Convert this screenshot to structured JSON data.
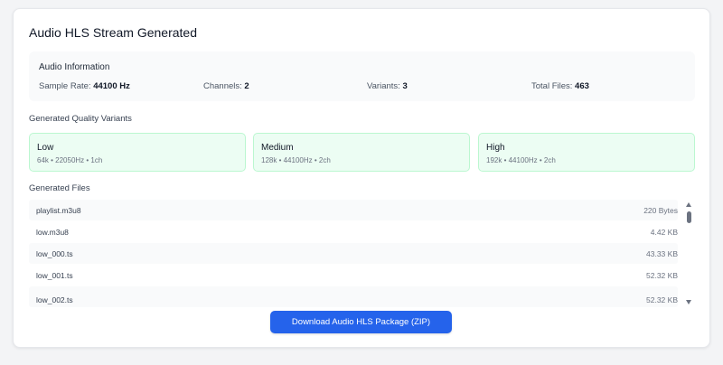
{
  "title": "Audio HLS Stream Generated",
  "audio_info": {
    "heading": "Audio Information",
    "items": [
      {
        "label": "Sample Rate:",
        "value": "44100 Hz"
      },
      {
        "label": "Channels:",
        "value": "2"
      },
      {
        "label": "Variants:",
        "value": "3"
      },
      {
        "label": "Total Files:",
        "value": "463"
      }
    ]
  },
  "variants_section": {
    "heading": "Generated Quality Variants",
    "items": [
      {
        "name": "Low",
        "detail": "64k • 22050Hz • 1ch"
      },
      {
        "name": "Medium",
        "detail": "128k • 44100Hz • 2ch"
      },
      {
        "name": "High",
        "detail": "192k • 44100Hz • 2ch"
      }
    ]
  },
  "files_section": {
    "heading": "Generated Files",
    "files": [
      {
        "name": "playlist.m3u8",
        "size": "220 Bytes"
      },
      {
        "name": "low.m3u8",
        "size": "4.42 KB"
      },
      {
        "name": "low_000.ts",
        "size": "43.33 KB"
      },
      {
        "name": "low_001.ts",
        "size": "52.32 KB"
      },
      {
        "name": "low_002.ts",
        "size": "52.32 KB"
      }
    ]
  },
  "download_button": {
    "label": "Download Audio HLS Package (ZIP)"
  },
  "colors": {
    "accent": "#2563eb",
    "variant_bg": "#ecfdf3",
    "variant_border": "#bbf7d0"
  }
}
